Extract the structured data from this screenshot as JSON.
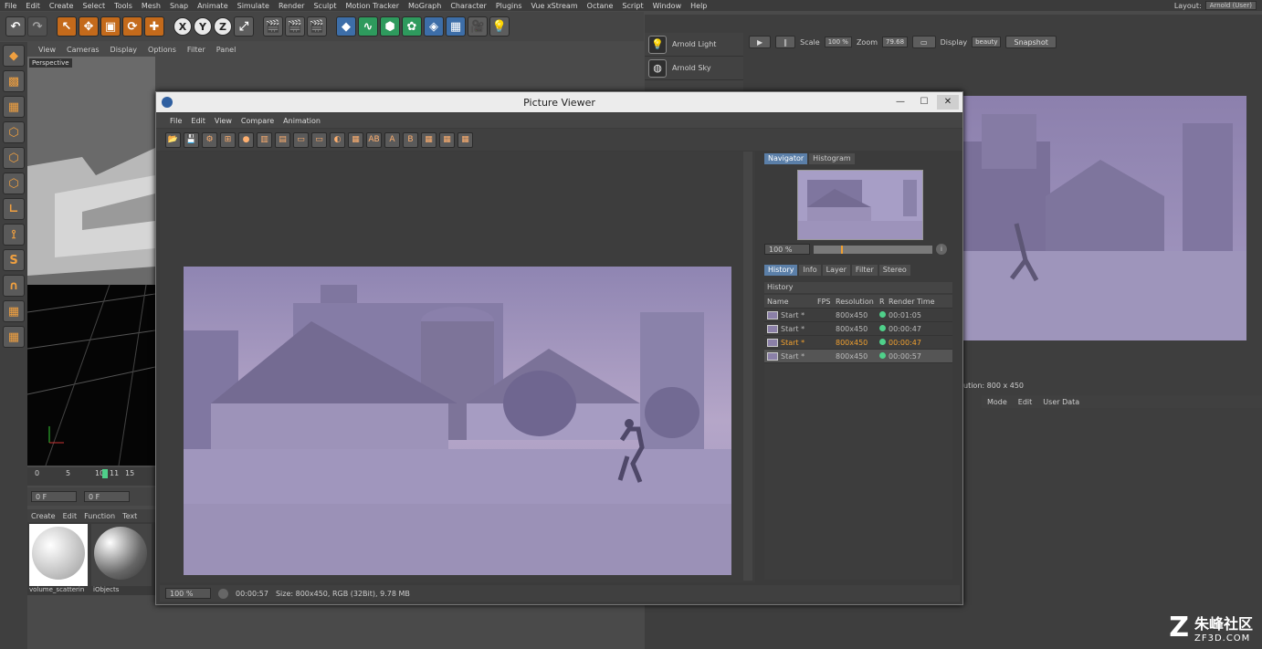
{
  "menubar": [
    "File",
    "Edit",
    "Create",
    "Select",
    "Tools",
    "Mesh",
    "Snap",
    "Animate",
    "Simulate",
    "Render",
    "Sculpt",
    "Motion Tracker",
    "MoGraph",
    "Character",
    "Plugins",
    "Vue xStream",
    "Octane",
    "Script",
    "Window",
    "Help"
  ],
  "layout": {
    "label": "Layout:",
    "value": "Arnold (User)"
  },
  "viewport_menu": [
    "View",
    "Cameras",
    "Display",
    "Options",
    "Filter",
    "Panel"
  ],
  "viewport_label": "Perspective",
  "timeline": {
    "ticks": [
      "0",
      "5",
      "10",
      "11",
      "15"
    ],
    "frame_a": "0 F",
    "frame_b": "0 F"
  },
  "material_menu": [
    "Create",
    "Edit",
    "Function",
    "Text"
  ],
  "materials": [
    "volume_scatterin",
    "iObjects"
  ],
  "objects": [
    {
      "icon": "bulb-icon",
      "label": "Arnold Light"
    },
    {
      "icon": "sky-icon",
      "label": "Arnold Sky"
    }
  ],
  "ipr": {
    "scale_label": "Scale",
    "scale_value": "100 %",
    "zoom_label": "Zoom",
    "zoom_value": "79.68",
    "display_label": "Display",
    "display_value": "beauty",
    "snapshot": "Snapshot",
    "status": "ution: 800 x 450"
  },
  "attr_menu": [
    "Mode",
    "Edit",
    "User Data"
  ],
  "picture_viewer": {
    "title": "Picture Viewer",
    "menu": [
      "File",
      "Edit",
      "View",
      "Compare",
      "Animation"
    ],
    "nav_tabs": [
      "Navigator",
      "Histogram"
    ],
    "nav_zoom": "100 %",
    "hist_tabs": [
      "History",
      "Info",
      "Layer",
      "Filter",
      "Stereo"
    ],
    "history_title": "History",
    "columns": [
      "Name",
      "FPS",
      "Resolution",
      "R",
      "Render Time"
    ],
    "rows": [
      {
        "name": "Start *",
        "res": "800x450",
        "time": "00:01:05"
      },
      {
        "name": "Start *",
        "res": "800x450",
        "time": "00:00:47"
      },
      {
        "name": "Start *",
        "res": "800x450",
        "time": "00:00:47"
      },
      {
        "name": "Start *",
        "res": "800x450",
        "time": "00:00:57"
      }
    ],
    "status": {
      "zoom": "100 %",
      "time": "00:00:57",
      "info": "Size: 800x450, RGB (32Bit), 9.78 MB"
    }
  },
  "watermark": {
    "brand": "朱峰社区",
    "url": "ZF3D.COM"
  }
}
